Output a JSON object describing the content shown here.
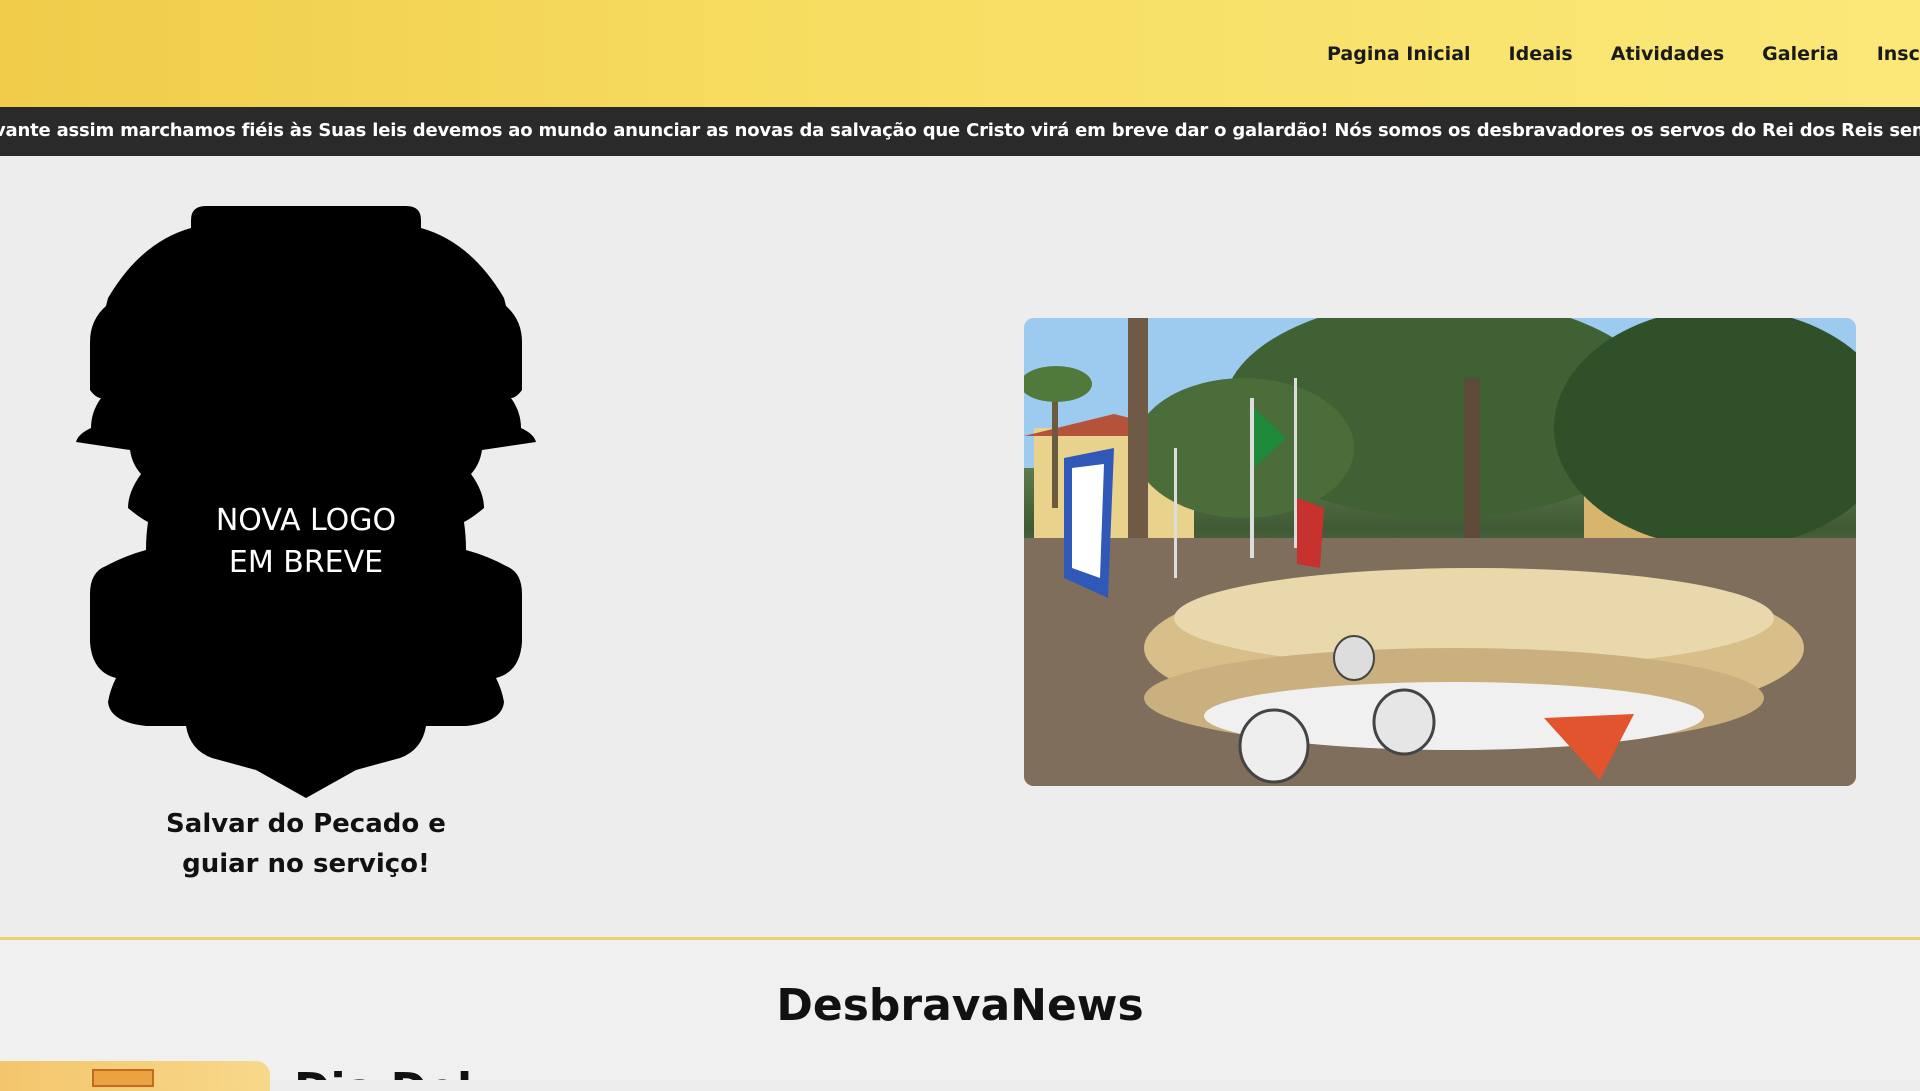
{
  "nav": {
    "items": [
      "Pagina Inicial",
      "Ideais",
      "Atividades",
      "Galeria",
      "Inscriçõ"
    ]
  },
  "marquee": {
    "text": "vante assim marchamos fiéis às Suas leis devemos ao mundo anunciar as novas da salvação que Cristo virá em breve dar o galardão! Nós somos os desbravadores os servos do Rei dos Reis sempre avante assim marcha"
  },
  "logo": {
    "line1": "NOVA LOGO",
    "line2": "EM BREVE",
    "icon": "shield-silhouette-icon"
  },
  "motto": {
    "line1": "Salvar do Pecado e",
    "line2": "guiar no serviço!"
  },
  "news": {
    "title": "DesbravaNews",
    "headline": "Dia Del"
  },
  "colors": {
    "header_start": "#f0cc4a",
    "header_end": "#fbe879",
    "marquee_bg": "#2a2a2a",
    "page_bg": "#ededed",
    "divider": "#ead372"
  }
}
